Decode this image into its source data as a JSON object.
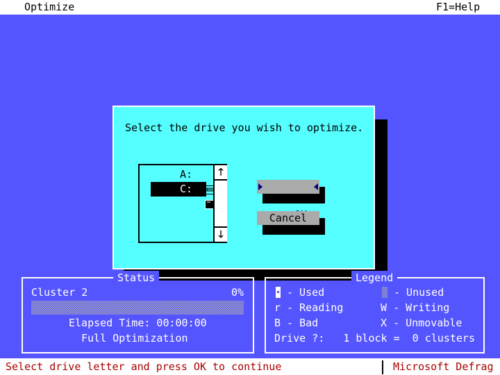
{
  "menu": {
    "title": "Optimize",
    "help": "F1=Help"
  },
  "dialog": {
    "prompt": "Select the drive you wish to optimize.",
    "drives": [
      {
        "label": "A:",
        "icon": "floppy-drive-icon",
        "selected": false
      },
      {
        "label": "C:",
        "icon": "hard-drive-icon",
        "selected": true
      }
    ],
    "ok_label": "OK",
    "cancel_label": "Cancel"
  },
  "status": {
    "title": "Status",
    "cluster": "Cluster 2",
    "percent": "0%",
    "progress_fraction": 0,
    "elapsed": "Elapsed Time: 00:00:00",
    "mode": "Full Optimization"
  },
  "legend": {
    "title": "Legend",
    "used": "- Used",
    "unused": "- Unused",
    "reading": "r - Reading",
    "writing": "W - Writing",
    "bad": "B - Bad",
    "unmovable": "X - Unmovable",
    "drive_info": "Drive ?:   1 block =  0 clusters"
  },
  "statusbar": {
    "message": "Select drive letter and press OK to continue",
    "app": "Microsoft Defrag"
  },
  "colors": {
    "desktop": "#5555ff",
    "dialog": "#55ffff",
    "button": "#aaaaaa",
    "status_text": "#aa0000"
  }
}
